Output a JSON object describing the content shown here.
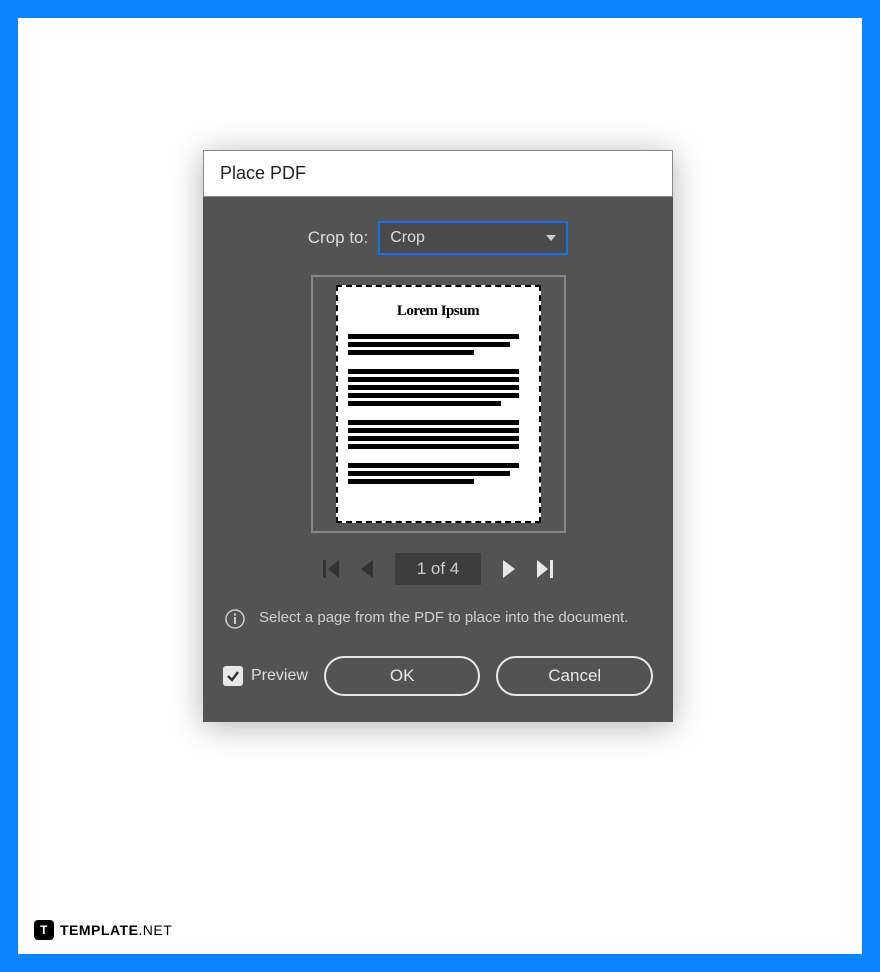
{
  "dialog": {
    "title": "Place PDF",
    "cropLabel": "Crop to:",
    "cropValue": "Crop",
    "previewHeading": "Lorem Ipsum",
    "pageIndicator": "1 of 4",
    "infoText": "Select a page from the PDF to place into the document.",
    "previewCheckbox": "Preview",
    "okLabel": "OK",
    "cancelLabel": "Cancel"
  },
  "brand": {
    "name": "TEMPLATE",
    "suffix": ".NET"
  }
}
